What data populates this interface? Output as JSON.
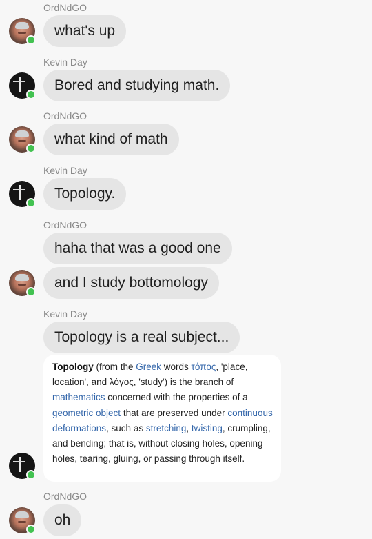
{
  "messages": [
    {
      "sender": "OrdNdGO",
      "text": "what's up"
    },
    {
      "sender": "Kevin Day",
      "text": "Bored and studying math."
    },
    {
      "sender": "OrdNdGO",
      "text": "what kind of math"
    },
    {
      "sender": "Kevin Day",
      "text": "Topology."
    },
    {
      "sender": "OrdNdGO",
      "text": "haha that was a good one",
      "text2": "and I study bottomology"
    },
    {
      "sender": "Kevin Day",
      "text": "Topology is a real subject..."
    },
    {
      "sender": "OrdNdGO",
      "text": "oh"
    }
  ],
  "wiki": {
    "term": "Topology",
    "t1": " (from the ",
    "l_greek": "Greek",
    "t2": " words ",
    "l_topos": "τόπος",
    "t3": ", 'place, location', and λόγος, 'study') is the branch of ",
    "l_math": "mathematics",
    "t4": " concerned with the properties of a ",
    "l_geo": "geometric object",
    "t5": " that are preserved under ",
    "l_cont": "continuous deformations",
    "t6": ", such as ",
    "l_stretch": "stretching",
    "t7": ", ",
    "l_twist": "twisting",
    "t8": ", crumpling, and bending; that is, without closing holes, opening holes, tearing, gluing, or passing through itself."
  },
  "colors": {
    "bubble": "#e5e5e5",
    "online": "#43c251",
    "link": "#3366aa"
  },
  "icons": {
    "ordndgo_avatar": "avatar-icon",
    "kevin_avatar": "avatar-icon",
    "presence": "online-dot-icon"
  }
}
